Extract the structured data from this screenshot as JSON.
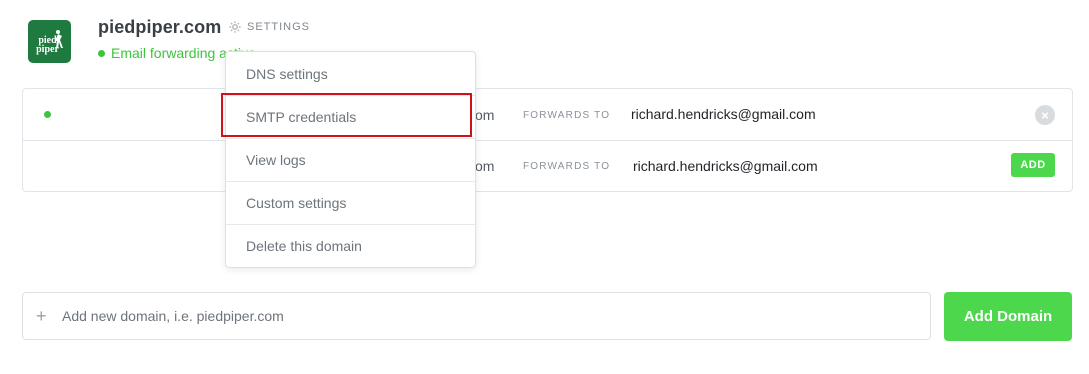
{
  "header": {
    "logo_text_line1": "pied",
    "logo_text_line2": "piper",
    "domain": "piedpiper.com",
    "settings_label": "SETTINGS",
    "status_text": "Email forwarding active"
  },
  "settings_menu": {
    "items": [
      {
        "label": "DNS settings"
      },
      {
        "label": "SMTP credentials",
        "highlighted": true
      },
      {
        "label": "View logs"
      },
      {
        "label": "Custom settings"
      },
      {
        "label": "Delete this domain"
      }
    ]
  },
  "forwards": {
    "forwards_to_label": "FORWARDS TO",
    "rows": [
      {
        "alias_suffix": "om",
        "email": "richard.hendricks@gmail.com",
        "action": "remove",
        "action_label": "×",
        "status": "active"
      },
      {
        "alias_suffix": "om",
        "email": "richard.hendricks@gmail.com",
        "action": "add",
        "action_label": "ADD"
      }
    ]
  },
  "add_domain": {
    "placeholder": "Add new domain, i.e. piedpiper.com",
    "value": "",
    "button_label": "Add Domain"
  },
  "colors": {
    "accent_green": "#4cd74c",
    "status_green": "#3dc43d",
    "logo_green": "#1f7a3f",
    "highlight_red": "#d0101a"
  },
  "icons": [
    "gear-icon",
    "plus-icon",
    "close-icon"
  ]
}
